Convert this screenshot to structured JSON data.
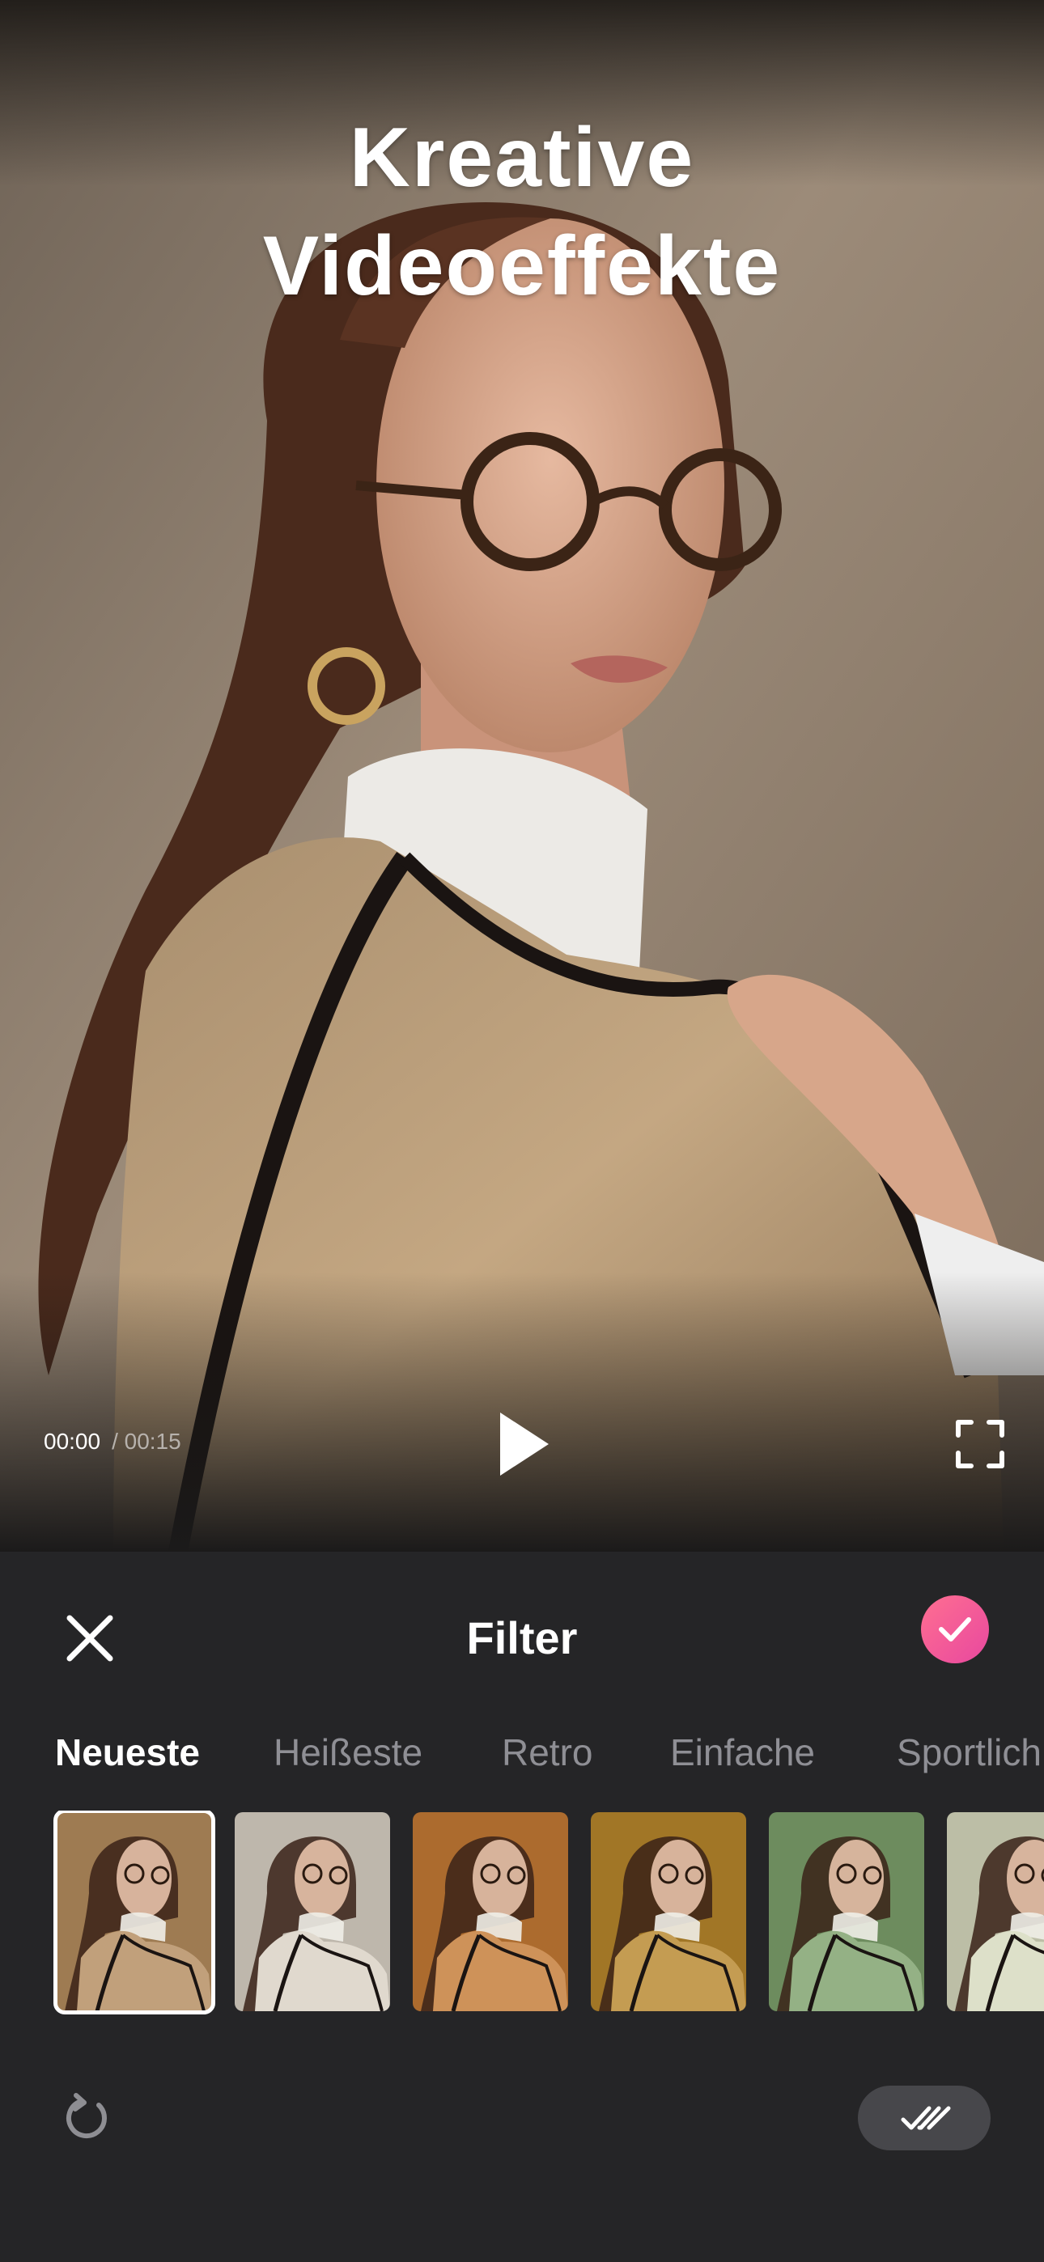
{
  "preview": {
    "headline_line1": "Kreative",
    "headline_line2": "Videoeffekte",
    "time_current": "00:00",
    "time_total": "/ 00:15"
  },
  "panel": {
    "title": "Filter",
    "tabs": [
      {
        "label": "Neueste",
        "active": true
      },
      {
        "label": "Heißeste",
        "active": false
      },
      {
        "label": "Retro",
        "active": false
      },
      {
        "label": "Einfache",
        "active": false
      },
      {
        "label": "Sportlich",
        "active": false
      }
    ],
    "thumbnails": [
      {
        "tint": "#b48c5e",
        "selected": true
      },
      {
        "tint": "#d9d1c4",
        "selected": false
      },
      {
        "tint": "#c47a35",
        "selected": false
      },
      {
        "tint": "#b8872c",
        "selected": false
      },
      {
        "tint": "#7da06b",
        "selected": false
      },
      {
        "tint": "#d6d9bd",
        "selected": false
      }
    ]
  },
  "icons": {
    "close": "close-icon",
    "confirm": "check-icon",
    "play": "play-icon",
    "fullscreen": "fullscreen-icon",
    "reset": "reset-icon",
    "apply_all": "double-check-icon"
  },
  "colors": {
    "panel_bg": "#252527",
    "accent_gradient_start": "#ff6f91",
    "accent_gradient_end": "#e8489f",
    "tab_inactive": "#8f8f95"
  }
}
